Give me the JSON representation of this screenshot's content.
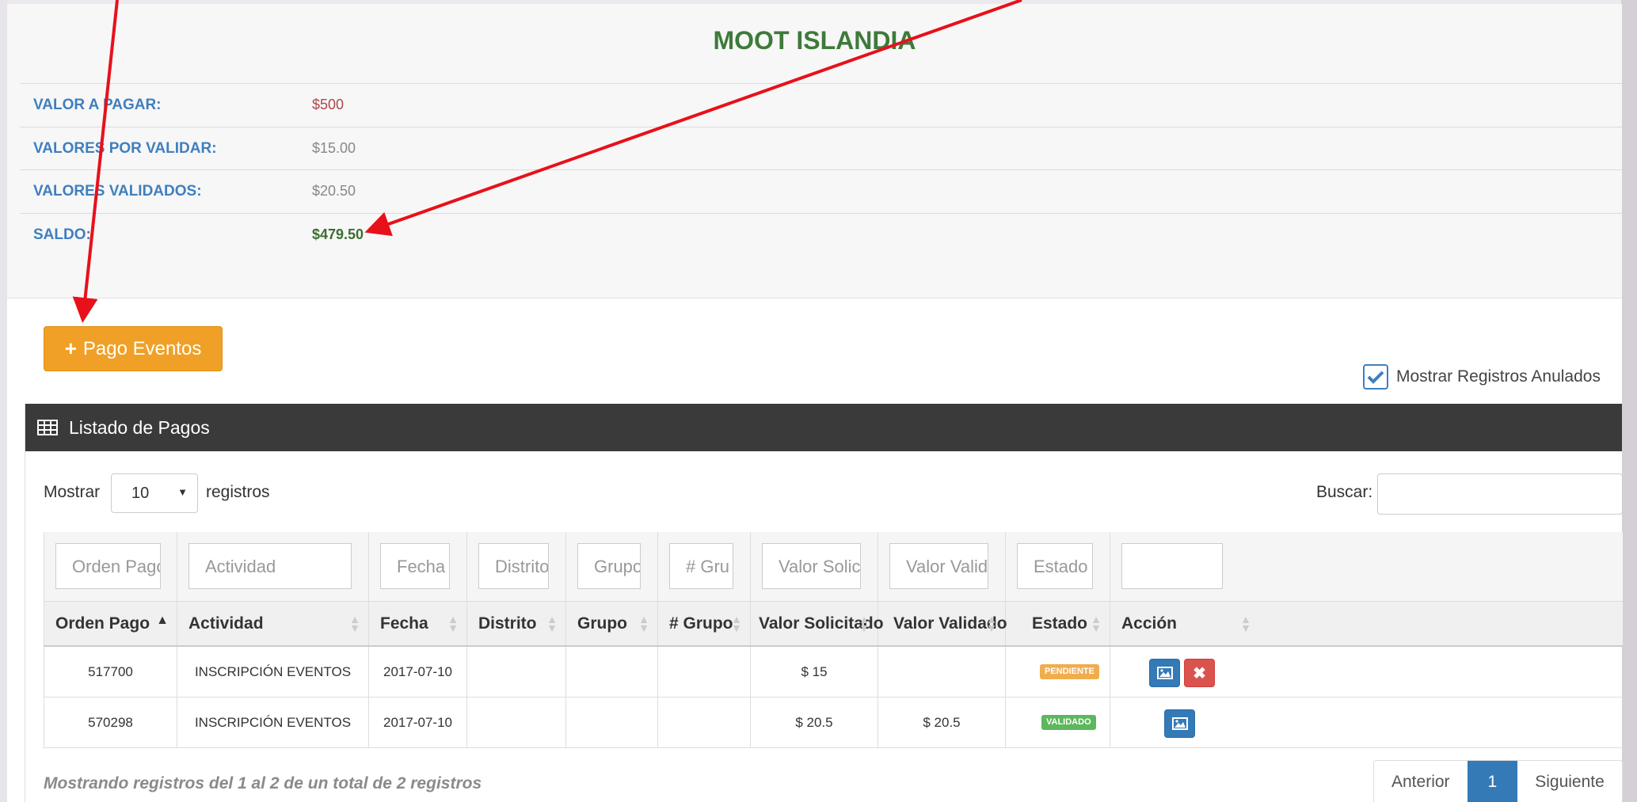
{
  "summary": {
    "title": "MOOT ISLANDIA",
    "rows": [
      {
        "label": "VALOR A PAGAR:",
        "value": "$500"
      },
      {
        "label": "VALORES POR VALIDAR:",
        "value": "$15.00"
      },
      {
        "label": "VALORES VALIDADOS:",
        "value": "$20.50"
      },
      {
        "label": "SALDO:",
        "value": "$479.50"
      }
    ]
  },
  "actions": {
    "add_label": "Pago Eventos",
    "show_cancelled_label": "Mostrar Registros Anulados"
  },
  "listing": {
    "title": "Listado de Pagos",
    "length_prefix": "Mostrar",
    "length_value": "10",
    "length_suffix": "registros",
    "search_label": "Buscar:",
    "filters": [
      "Orden Pago",
      "Actividad",
      "Fecha",
      "Distrito",
      "Grupo",
      "# Gru",
      "Valor Solici",
      "Valor Valida",
      "Estado",
      ""
    ],
    "columns": [
      "Orden Pago",
      "Actividad",
      "Fecha",
      "Distrito",
      "Grupo",
      "# Grupo",
      "Valor Solicitado",
      "Valor Validado",
      "Estado",
      "Acción"
    ],
    "rows": [
      {
        "orden": "517700",
        "actividad": "INSCRIPCIÓN EVENTOS",
        "fecha": "2017-07-10",
        "distrito": "",
        "grupo": "",
        "num_grupo": "",
        "valor_solicitado": "$ 15",
        "valor_validado": "",
        "estado": "PENDIENTE"
      },
      {
        "orden": "570298",
        "actividad": "INSCRIPCIÓN EVENTOS",
        "fecha": "2017-07-10",
        "distrito": "",
        "grupo": "",
        "num_grupo": "",
        "valor_solicitado": "$ 20.5",
        "valor_validado": "$ 20.5",
        "estado": "VALIDADO"
      }
    ],
    "info": "Mostrando registros del 1 al 2 de un total de 2 registros",
    "pagination": {
      "prev": "Anterior",
      "current": "1",
      "next": "Siguiente"
    }
  },
  "colors": {
    "accent": "#3f7fbf",
    "title_green": "#3e7a3a",
    "add_button": "#f0a027",
    "header_dark": "#3a3a3a",
    "annotation_arrow": "#e8101a"
  }
}
